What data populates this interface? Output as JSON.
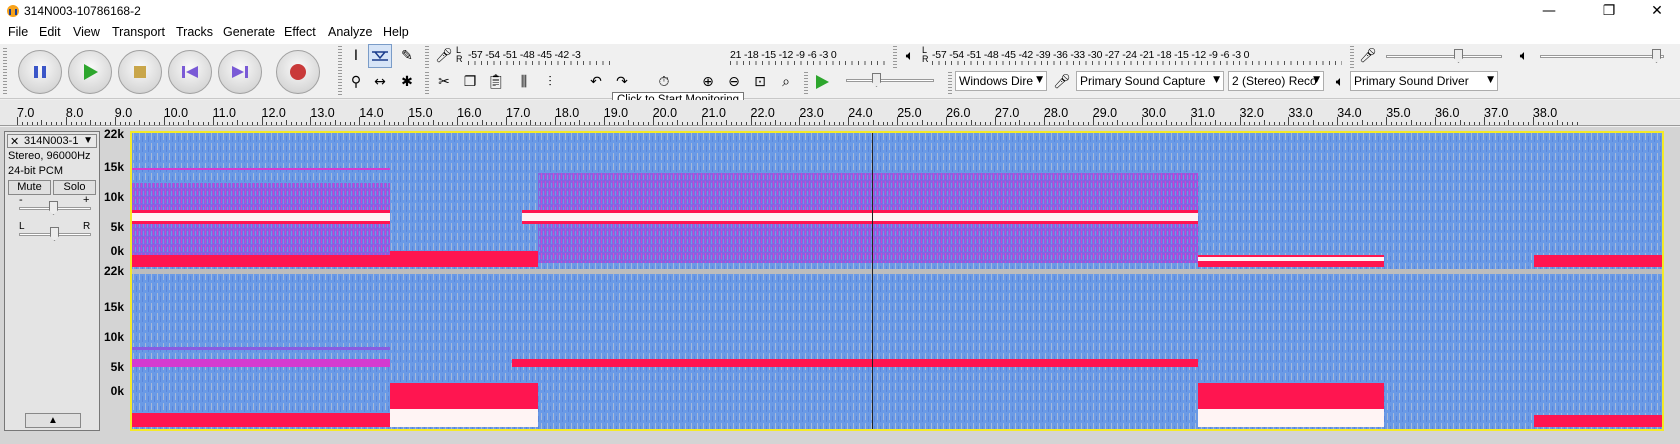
{
  "window": {
    "title": "314N003-10786168-2",
    "minimize": "—",
    "maximize": "❐",
    "close": "✕"
  },
  "menu": [
    "File",
    "Edit",
    "View",
    "Transport",
    "Tracks",
    "Generate",
    "Effect",
    "Analyze",
    "Help"
  ],
  "transport": {
    "pause": "pause-icon",
    "play": "play-icon",
    "stop": "stop-icon",
    "skip_start": "skip-to-start-icon",
    "skip_end": "skip-to-end-icon",
    "record": "record-icon"
  },
  "meters": {
    "record_scale": "-57 -54 -51 -48 -45 -42 -3",
    "record_scale_tail": "21 -18 -15 -12  -9  -6  -3  0",
    "playback_scale": "-57 -54 -51 -48 -45 -42 -39 -36 -33 -30 -27 -24 -21 -18 -15 -12  -9  -6  -3  0",
    "lr": "L\nR"
  },
  "tooltip": "Click to Start Monitoring",
  "devices": {
    "host": "Windows Dire",
    "recording_device": "Primary Sound Capture",
    "channels": "2 (Stereo) Reco",
    "playback_device": "Primary Sound Driver"
  },
  "ruler": {
    "labels": [
      "7.0",
      "8.0",
      "9.0",
      "10.0",
      "11.0",
      "12.0",
      "13.0",
      "14.0",
      "15.0",
      "16.0",
      "17.0",
      "18.0",
      "19.0",
      "20.0",
      "21.0",
      "22.0",
      "23.0",
      "24.0",
      "25.0",
      "26.0",
      "27.0",
      "28.0",
      "29.0",
      "30.0",
      "31.0",
      "32.0",
      "33.0",
      "34.0",
      "35.0",
      "36.0",
      "37.0",
      "38.0"
    ]
  },
  "track": {
    "name": "314N003-1",
    "info_format": "Stereo, 96000Hz",
    "info_bits": "24-bit PCM",
    "mute": "Mute",
    "solo": "Solo",
    "gain_min": "-",
    "gain_max": "+",
    "pan_left": "L",
    "pan_right": "R",
    "collapse": "▲",
    "close": "✕",
    "menu_arrow": "▼"
  },
  "freq_scale": {
    "channel1": [
      "22k",
      "15k",
      "10k",
      "5k",
      "0k"
    ],
    "channel2": [
      "22k",
      "15k",
      "10k",
      "5k",
      "0k"
    ]
  },
  "colors": {
    "spectrum_low": "#6a9ae6",
    "spectrum_mid": "#d43bd0",
    "spectrum_high": "#ff1550",
    "spectrum_peak": "#ffffff",
    "selection_border": "#f4ea27"
  }
}
